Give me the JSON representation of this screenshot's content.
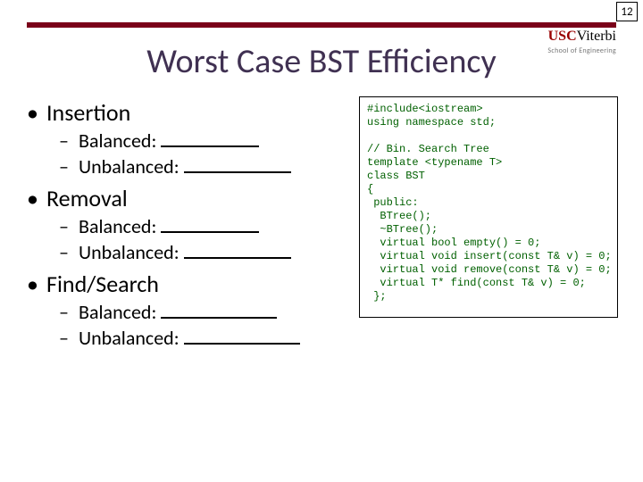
{
  "page_number": "12",
  "logo": {
    "usc": "USC",
    "viterbi": "Viterbi",
    "sub": "School of Engineering"
  },
  "title": "Worst Case BST Efficiency",
  "bullets": {
    "insertion": "Insertion",
    "removal": "Removal",
    "find": "Find/Search",
    "balanced": "Balanced:",
    "unbalanced": "Unbalanced:"
  },
  "code": "#include<iostream>\nusing namespace std;\n\n// Bin. Search Tree\ntemplate <typename T>\nclass BST\n{\n public:\n  BTree();\n  ~BTree();\n  virtual bool empty() = 0;\n  virtual void insert(const T& v) = 0;\n  virtual void remove(const T& v) = 0;\n  virtual T* find(const T& v) = 0;\n };"
}
